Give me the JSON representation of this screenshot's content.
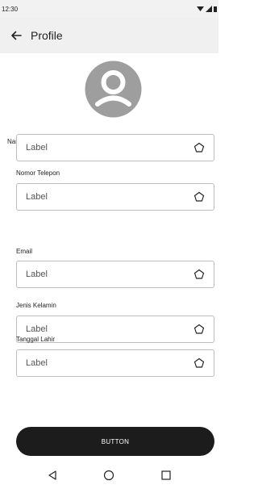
{
  "status_bar": {
    "time": "12:30"
  },
  "app_bar": {
    "title": "Profile",
    "back_icon": "arrow-left-icon"
  },
  "form": {
    "fields": [
      {
        "label": "Nama",
        "value": "Label"
      },
      {
        "label": "Nomor Telepon",
        "value": "Label"
      },
      {
        "label": "Email",
        "value": "Label"
      },
      {
        "label": "Jenis Kelamin",
        "value": "Label"
      },
      {
        "label": "Tanggal Lahir",
        "value": "Label"
      }
    ]
  },
  "button": {
    "label": "BUTTON"
  },
  "colors": {
    "button_bg": "#1c1c1c",
    "app_bar_bg": "#f0f0f0",
    "avatar": "#9e9e9e"
  }
}
